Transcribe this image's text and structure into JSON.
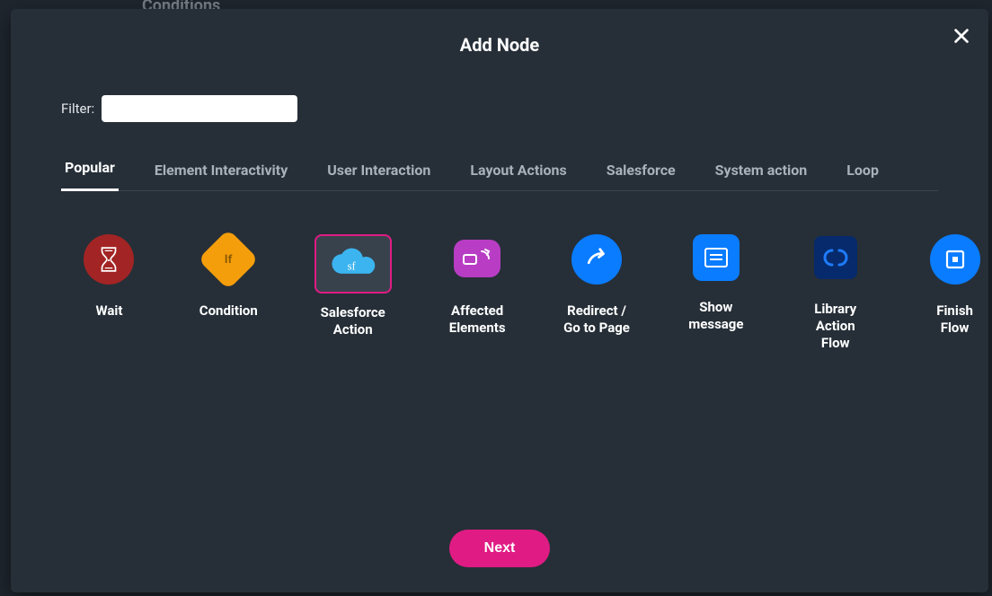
{
  "behind": "Conditions",
  "modal": {
    "title": "Add Node",
    "filter_label": "Filter:",
    "filter_value": "",
    "tabs": [
      {
        "label": "Popular",
        "active": true
      },
      {
        "label": "Element Interactivity",
        "active": false
      },
      {
        "label": "User Interaction",
        "active": false
      },
      {
        "label": "Layout Actions",
        "active": false
      },
      {
        "label": "Salesforce",
        "active": false
      },
      {
        "label": "System action",
        "active": false
      },
      {
        "label": "Loop",
        "active": false
      }
    ],
    "nodes": [
      {
        "id": "wait",
        "label": "Wait"
      },
      {
        "id": "condition",
        "label": "Condition"
      },
      {
        "id": "salesforce-action",
        "label": "Salesforce Action",
        "selected": true
      },
      {
        "id": "affected-elements",
        "label": "Affected Elements"
      },
      {
        "id": "redirect",
        "label": "Redirect / Go to Page"
      },
      {
        "id": "show-message",
        "label": "Show message"
      },
      {
        "id": "library-action-flow",
        "label": "Library Action Flow"
      },
      {
        "id": "finish-flow",
        "label": "Finish Flow"
      }
    ],
    "next_label": "Next"
  }
}
